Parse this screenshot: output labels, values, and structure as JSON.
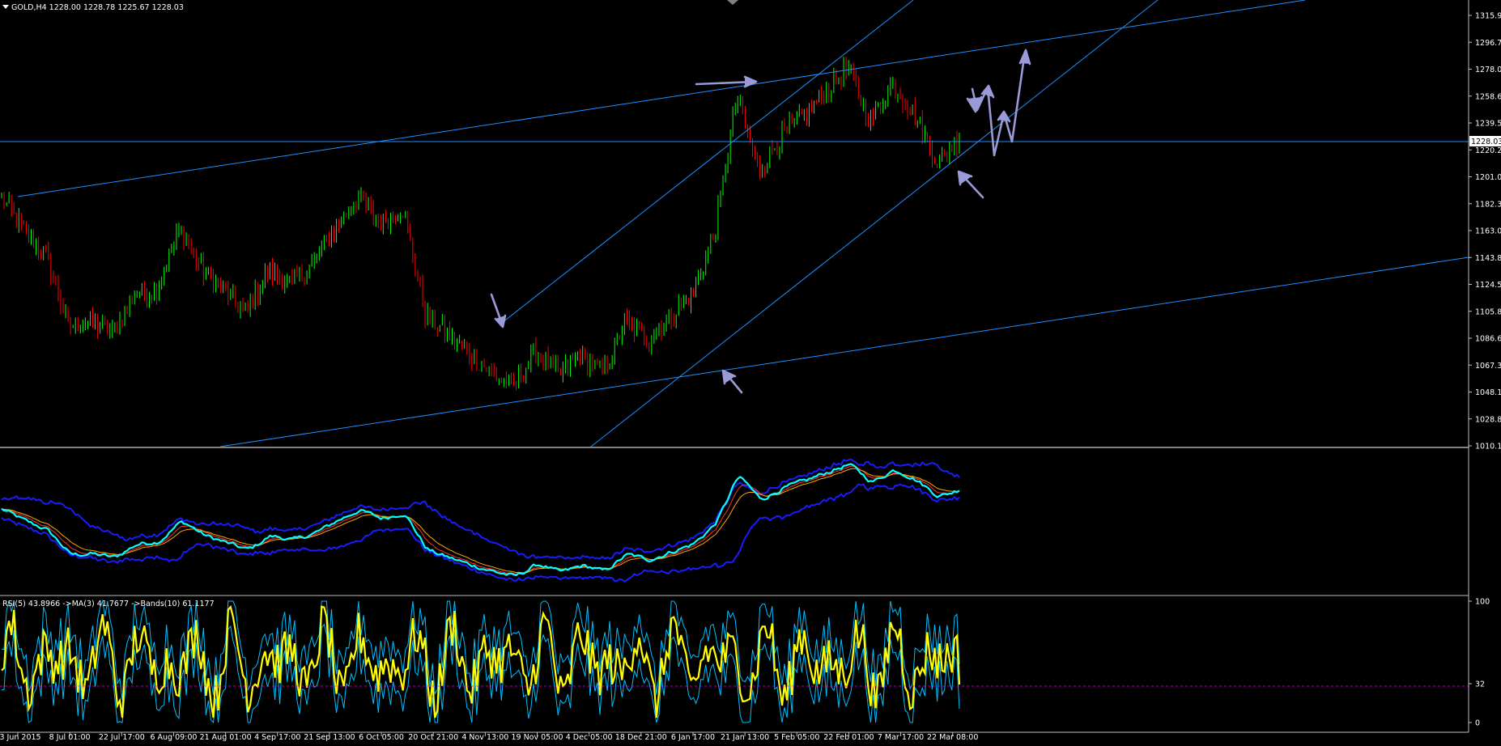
{
  "header": {
    "symbol_line": "GOLD,H4  1228.00 1228.78 1225.67 1228.03",
    "menu_icon": "triangle-down-icon"
  },
  "price_axis": {
    "ticks": [
      "1315.95",
      "1296.70",
      "1278.00",
      "1258.65",
      "1239.50",
      "1220.25",
      "1201.00",
      "1182.30",
      "1163.05",
      "1143.80",
      "1124.55",
      "1105.80",
      "1086.60",
      "1067.35",
      "1048.10",
      "1028.85",
      "1010.15"
    ],
    "current_price": "1228.03",
    "ylim": [
      1010.15,
      1315.95
    ]
  },
  "time_axis": {
    "labels": [
      "23 Jun 2015",
      "8 Jul 01:00",
      "22 Jul 17:00",
      "6 Aug 09:00",
      "21 Aug 01:00",
      "4 Sep 17:00",
      "21 Sep 13:00",
      "6 Oct 05:00",
      "20 Oct 21:00",
      "4 Nov 13:00",
      "19 Nov 05:00",
      "4 Dec 05:00",
      "18 Dec 21:00",
      "6 Jan 17:00",
      "21 Jan 13:00",
      "5 Feb 05:00",
      "22 Feb 01:00",
      "7 Mar 17:00",
      "22 Mar 08:00"
    ]
  },
  "rsi_panel": {
    "legend": "RSI(5) 43.8966  ->MA(3) 41.7677  ->Bands(10) 61.1177",
    "levels": [
      "100",
      "32",
      "0"
    ],
    "ylim": [
      0,
      100
    ]
  },
  "colors": {
    "background": "#000000",
    "bull_candle": "#00ff00",
    "bear_candle": "#ff0000",
    "trendline": "#1e90ff",
    "arrow": "#9a9ad8",
    "indicator_main": "#00ffff",
    "indicator_bands": "#1a1aff",
    "rsi_line": "#ffff00",
    "rsi_bands": "#00bfff",
    "level_line": "#ff00ff",
    "axis_text": "#ffffff",
    "current_price_bg": "#ffffff"
  },
  "chart_data": {
    "type": "candlestick",
    "symbol": "GOLD",
    "timeframe": "H4",
    "last_bar": {
      "open": 1228.0,
      "high": 1228.78,
      "low": 1225.67,
      "close": 1228.03
    },
    "close_path": [
      {
        "x": "23 Jun 2015",
        "y": 1186
      },
      {
        "x": "8 Jul 01:00",
        "y": 1163
      },
      {
        "x": "14 Jul",
        "y": 1145
      },
      {
        "x": "20 Jul",
        "y": 1095
      },
      {
        "x": "22 Jul 17:00",
        "y": 1098
      },
      {
        "x": "30 Jul",
        "y": 1090
      },
      {
        "x": "6 Aug 09:00",
        "y": 1118
      },
      {
        "x": "14 Aug",
        "y": 1122
      },
      {
        "x": "21 Aug 01:00",
        "y": 1165
      },
      {
        "x": "28 Aug",
        "y": 1135
      },
      {
        "x": "4 Sep 17:00",
        "y": 1120
      },
      {
        "x": "10 Sep",
        "y": 1105
      },
      {
        "x": "21 Sep 13:00",
        "y": 1135
      },
      {
        "x": "28 Sep",
        "y": 1125
      },
      {
        "x": "6 Oct 05:00",
        "y": 1140
      },
      {
        "x": "12 Oct",
        "y": 1165
      },
      {
        "x": "15 Oct",
        "y": 1186
      },
      {
        "x": "20 Oct 21:00",
        "y": 1168
      },
      {
        "x": "28 Oct",
        "y": 1180
      },
      {
        "x": "4 Nov 13:00",
        "y": 1105
      },
      {
        "x": "10 Nov",
        "y": 1090
      },
      {
        "x": "19 Nov 05:00",
        "y": 1075
      },
      {
        "x": "27 Nov",
        "y": 1062
      },
      {
        "x": "4 Dec 05:00",
        "y": 1052
      },
      {
        "x": "8 Dec",
        "y": 1078
      },
      {
        "x": "18 Dec 21:00",
        "y": 1060
      },
      {
        "x": "24 Dec",
        "y": 1075
      },
      {
        "x": "31 Dec",
        "y": 1062
      },
      {
        "x": "6 Jan 17:00",
        "y": 1098
      },
      {
        "x": "12 Jan",
        "y": 1085
      },
      {
        "x": "21 Jan 13:00",
        "y": 1102
      },
      {
        "x": "27 Jan",
        "y": 1118
      },
      {
        "x": "5 Feb 05:00",
        "y": 1160
      },
      {
        "x": "10 Feb",
        "y": 1258
      },
      {
        "x": "15 Feb",
        "y": 1205
      },
      {
        "x": "22 Feb 01:00",
        "y": 1230
      },
      {
        "x": "1 Mar",
        "y": 1245
      },
      {
        "x": "7 Mar 17:00",
        "y": 1262
      },
      {
        "x": "10 Mar",
        "y": 1278
      },
      {
        "x": "13 Mar",
        "y": 1240
      },
      {
        "x": "16 Mar",
        "y": 1268
      },
      {
        "x": "19 Mar",
        "y": 1245
      },
      {
        "x": "22 Mar 08:00",
        "y": 1212
      },
      {
        "x": "24 Mar",
        "y": 1228
      }
    ]
  }
}
